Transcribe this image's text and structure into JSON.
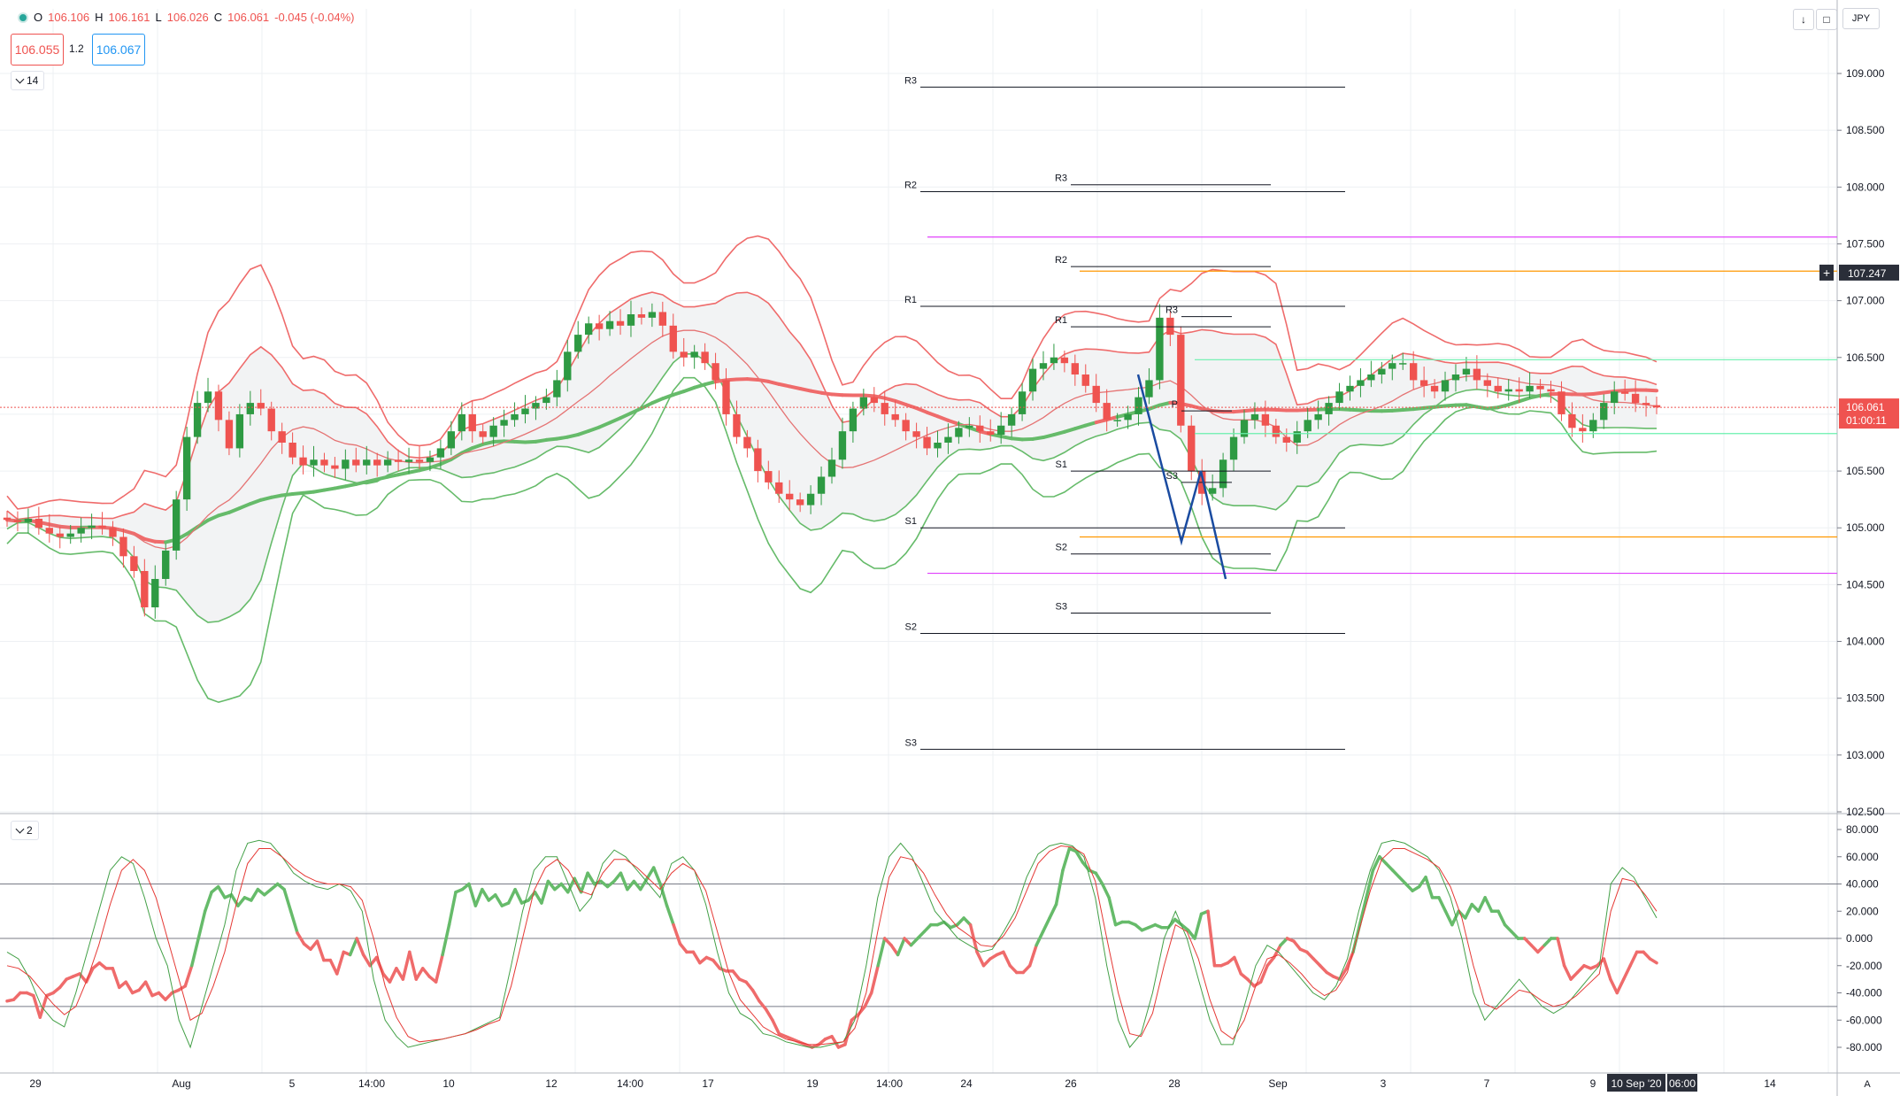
{
  "header": {
    "open_label": "O",
    "open": "106.106",
    "high_label": "H",
    "high": "106.161",
    "low_label": "L",
    "low": "106.026",
    "close_label": "C",
    "close": "106.061",
    "change": "-0.045 (-0.04%)",
    "sell_price": "106.055",
    "spread": "1.2",
    "buy_price": "106.067",
    "currency": "JPY",
    "price_indicator_label": "14",
    "oscillator_indicator_label": "2",
    "icons": [
      "symbol-status-icon",
      "chevron-down-icon",
      "download-arrow-icon",
      "maximize-icon",
      "currency-menu"
    ]
  },
  "colors": {
    "up": "#26a69a",
    "up_candle": "#2e9a43",
    "down": "#ef5350",
    "green_line": "#66bb6a",
    "red_line": "#ef6b6b",
    "pivot": "#131722",
    "magenta": "#e040fb",
    "orange": "#ff9800",
    "mint": "#69f0ae",
    "blue": "#1a4ba0"
  },
  "chart_data": [
    {
      "type": "candlestick",
      "symbol_currency": "JPY",
      "ylim": [
        102.5,
        109.3
      ],
      "y_ticks": [
        "109.000",
        "108.500",
        "108.000",
        "107.500",
        "107.000",
        "106.500",
        "106.000",
        "105.500",
        "105.000",
        "104.500",
        "104.000",
        "103.500",
        "103.000",
        "102.500"
      ],
      "x_ticks": [
        "29",
        "Aug",
        "5",
        "14:00",
        "10",
        "12",
        "14:00",
        "17",
        "19",
        "14:00",
        "24",
        "26",
        "28",
        "Sep",
        "3",
        "7",
        "9",
        "10 Sep '20",
        "06:00",
        "14"
      ],
      "last_price": "106.061",
      "countdown": "01:00:11",
      "cursor_price": "107.247",
      "close_series": [
        105.07,
        105.05,
        105.08,
        105.0,
        104.95,
        104.92,
        104.95,
        105.0,
        105.02,
        105.0,
        104.92,
        104.75,
        104.62,
        104.3,
        104.55,
        104.8,
        105.25,
        105.8,
        106.1,
        106.2,
        105.95,
        105.7,
        106.0,
        106.1,
        106.05,
        105.85,
        105.75,
        105.62,
        105.55,
        105.6,
        105.55,
        105.52,
        105.6,
        105.55,
        105.6,
        105.55,
        105.6,
        105.58,
        105.6,
        105.58,
        105.62,
        105.7,
        105.85,
        106.0,
        105.85,
        105.8,
        105.9,
        105.95,
        106.0,
        106.05,
        106.1,
        106.15,
        106.3,
        106.55,
        106.7,
        106.8,
        106.75,
        106.82,
        106.78,
        106.88,
        106.85,
        106.9,
        106.78,
        106.55,
        106.5,
        106.55,
        106.45,
        106.3,
        106.0,
        105.8,
        105.7,
        105.5,
        105.4,
        105.3,
        105.25,
        105.2,
        105.3,
        105.45,
        105.6,
        105.85,
        106.05,
        106.15,
        106.1,
        106.0,
        105.95,
        105.85,
        105.8,
        105.7,
        105.75,
        105.8,
        105.88,
        105.9,
        105.85,
        105.82,
        105.9,
        106.0,
        106.2,
        106.4,
        106.45,
        106.5,
        106.45,
        106.35,
        106.25,
        106.1,
        105.95,
        105.95,
        106.0,
        106.15,
        106.3,
        106.85,
        106.7,
        105.9,
        105.5,
        105.3,
        105.35,
        105.6,
        105.8,
        105.95,
        106.0,
        105.9,
        105.8,
        105.75,
        105.85,
        105.95,
        106.0,
        106.1,
        106.2,
        106.25,
        106.3,
        106.35,
        106.4,
        106.45,
        106.45,
        106.3,
        106.25,
        106.2,
        106.3,
        106.35,
        106.4,
        106.3,
        106.25,
        106.2,
        106.22,
        106.2,
        106.25,
        106.22,
        106.2,
        106.0,
        105.88,
        105.85,
        105.95,
        106.1,
        106.2,
        106.18,
        106.1,
        106.08,
        106.06
      ],
      "pivot_sets": [
        {
          "name": "weekly",
          "start_x": 1040,
          "end_x": 1520,
          "levels": [
            {
              "label": "R3",
              "value": 108.88
            },
            {
              "label": "R2",
              "value": 107.96
            },
            {
              "label": "R1",
              "value": 106.95
            },
            {
              "label": "S1",
              "value": 105.0
            },
            {
              "label": "S2",
              "value": 104.07
            },
            {
              "label": "S3",
              "value": 103.05
            }
          ]
        },
        {
          "name": "daily",
          "start_x": 1210,
          "end_x": 1436,
          "levels": [
            {
              "label": "R3",
              "value": 108.02
            },
            {
              "label": "R2",
              "value": 107.3
            },
            {
              "label": "R1",
              "value": 106.77
            },
            {
              "label": "S1",
              "value": 105.5
            },
            {
              "label": "S2",
              "value": 104.77
            },
            {
              "label": "S3",
              "value": 104.25
            }
          ]
        },
        {
          "name": "hourly",
          "start_x": 1335,
          "end_x": 1392,
          "levels": [
            {
              "label": "R3",
              "value": 106.86
            },
            {
              "label": "P",
              "value": 106.03
            },
            {
              "label": "S3",
              "value": 105.4
            }
          ]
        }
      ],
      "extra_lines": [
        {
          "value": 107.56,
          "color": "magenta",
          "start_x": 1048
        },
        {
          "value": 104.6,
          "color": "magenta",
          "start_x": 1048
        },
        {
          "value": 107.26,
          "color": "orange",
          "start_x": 1220
        },
        {
          "value": 104.92,
          "color": "orange",
          "start_x": 1220
        },
        {
          "value": 106.48,
          "color": "mint",
          "start_x": 1350
        },
        {
          "value": 105.83,
          "color": "mint",
          "start_x": 1350
        }
      ],
      "projection_path": [
        [
          1286,
          106.35
        ],
        [
          1335,
          104.88
        ],
        [
          1357,
          105.5
        ],
        [
          1385,
          104.55
        ]
      ]
    },
    {
      "type": "line",
      "ylim": [
        -90,
        90
      ],
      "y_ticks": [
        "80.000",
        "60.000",
        "40.000",
        "20.000",
        "0.000",
        "-20.000",
        "-40.000",
        "-60.000",
        "-80.000"
      ],
      "hlines": [
        40,
        0,
        -50
      ],
      "series": [
        {
          "role": "main",
          "values": [
            -46,
            -45,
            -40,
            -40,
            -42,
            -58,
            -42,
            -40,
            -36,
            -30,
            -28,
            -26,
            -32,
            -22,
            -18,
            -22,
            -22,
            -36,
            -32,
            -40,
            -38,
            -32,
            -42,
            -40,
            -45,
            -40,
            -38,
            -35,
            -20,
            0,
            20,
            34,
            38,
            30,
            32,
            24,
            30,
            28,
            36,
            32,
            36,
            40,
            36,
            20,
            4,
            -4,
            -8,
            -2,
            -16,
            -16,
            -26,
            -10,
            -12,
            0,
            -12,
            -20,
            -14,
            -26,
            -32,
            -22,
            -30,
            -10,
            -30,
            -22,
            -28,
            -32,
            -12,
            10,
            34,
            36,
            40,
            24,
            36,
            28,
            32,
            24,
            26,
            36,
            26,
            28,
            34,
            26,
            42,
            36,
            40,
            34,
            44,
            34,
            48,
            40,
            42,
            38,
            42,
            48,
            36,
            42,
            36,
            44,
            52,
            40,
            24,
            10,
            -4,
            -10,
            -10,
            -18,
            -14,
            -16,
            -22,
            -24,
            -24,
            -30,
            -32,
            -38,
            -46,
            -52,
            -60,
            -70,
            -72,
            -74,
            -76,
            -78,
            -80,
            -78,
            -74,
            -72,
            -80,
            -78,
            -60,
            -56,
            -50,
            -40,
            -20,
            0,
            -5,
            -12,
            0,
            -5,
            0,
            5,
            10,
            10,
            12,
            8,
            10,
            15,
            10,
            -10,
            -20,
            -15,
            -12,
            -10,
            -20,
            -25,
            -25,
            -20,
            -5,
            5,
            15,
            25,
            50,
            66,
            64,
            56,
            50,
            48,
            40,
            30,
            10,
            12,
            12,
            10,
            6,
            8,
            10,
            8,
            8,
            14,
            10,
            6,
            0,
            18,
            20,
            -20,
            -20,
            -18,
            -14,
            -26,
            -30,
            -35,
            -32,
            -20,
            -14,
            -5,
            0,
            -2,
            -8,
            -10,
            -15,
            -20,
            -25,
            -28,
            -30,
            -22,
            -10,
            10,
            30,
            50,
            60,
            55,
            50,
            45,
            40,
            35,
            38,
            45,
            30,
            30,
            20,
            10,
            20,
            15,
            25,
            20,
            30,
            20,
            20,
            10,
            5,
            0,
            0,
            -5,
            -10,
            -5,
            0,
            0,
            -20,
            -30,
            -25,
            -20,
            -22,
            -20,
            -15,
            -30,
            -40,
            -30,
            -20,
            -10,
            -10,
            -15,
            -18
          ]
        },
        {
          "role": "fast",
          "values": [
            -10,
            -15,
            -30,
            -50,
            -60,
            -65,
            -40,
            -10,
            20,
            50,
            60,
            55,
            30,
            0,
            -20,
            -60,
            -80,
            -50,
            -20,
            10,
            50,
            70,
            72,
            70,
            60,
            48,
            42,
            38,
            36,
            40,
            35,
            20,
            -30,
            -60,
            -72,
            -80,
            -78,
            -76,
            -74,
            -72,
            -70,
            -66,
            -62,
            -58,
            -20,
            20,
            50,
            60,
            60,
            40,
            20,
            30,
            55,
            65,
            60,
            50,
            40,
            30,
            55,
            60,
            50,
            25,
            -10,
            -40,
            -55,
            -60,
            -70,
            -72,
            -76,
            -78,
            -80,
            -80,
            -78,
            -76,
            -60,
            -20,
            30,
            60,
            70,
            60,
            40,
            20,
            10,
            0,
            -5,
            -10,
            -8,
            5,
            20,
            45,
            62,
            68,
            70,
            68,
            60,
            30,
            -20,
            -60,
            -80,
            -70,
            -40,
            0,
            20,
            0,
            -30,
            -60,
            -78,
            -78,
            -50,
            -20,
            -5,
            -10,
            -20,
            -30,
            -40,
            -45,
            -35,
            -15,
            20,
            50,
            70,
            72,
            70,
            65,
            60,
            50,
            30,
            0,
            -40,
            -60,
            -50,
            -40,
            -30,
            -40,
            -50,
            -55,
            -50,
            -40,
            -30,
            -20,
            40,
            52,
            45,
            30,
            15
          ]
        },
        {
          "role": "slow",
          "values": [
            -20,
            -22,
            -28,
            -38,
            -48,
            -56,
            -50,
            -30,
            -5,
            25,
            50,
            58,
            50,
            30,
            0,
            -30,
            -60,
            -55,
            -35,
            -10,
            25,
            55,
            66,
            66,
            60,
            52,
            46,
            42,
            40,
            40,
            38,
            28,
            0,
            -35,
            -58,
            -72,
            -76,
            -75,
            -74,
            -72,
            -70,
            -67,
            -63,
            -60,
            -35,
            0,
            35,
            52,
            58,
            50,
            35,
            32,
            48,
            58,
            58,
            52,
            44,
            36,
            48,
            55,
            50,
            35,
            5,
            -25,
            -45,
            -55,
            -65,
            -70,
            -74,
            -76,
            -78,
            -78,
            -77,
            -76,
            -66,
            -40,
            5,
            45,
            60,
            58,
            48,
            32,
            18,
            8,
            2,
            -5,
            -6,
            2,
            15,
            35,
            55,
            64,
            68,
            67,
            62,
            42,
            0,
            -40,
            -70,
            -72,
            -55,
            -20,
            10,
            5,
            -15,
            -45,
            -68,
            -74,
            -60,
            -35,
            -15,
            -12,
            -18,
            -26,
            -36,
            -42,
            -38,
            -25,
            5,
            35,
            58,
            66,
            66,
            62,
            58,
            52,
            38,
            15,
            -20,
            -48,
            -52,
            -45,
            -38,
            -40,
            -46,
            -50,
            -48,
            -42,
            -34,
            -26,
            20,
            44,
            42,
            32,
            20
          ]
        }
      ]
    }
  ]
}
